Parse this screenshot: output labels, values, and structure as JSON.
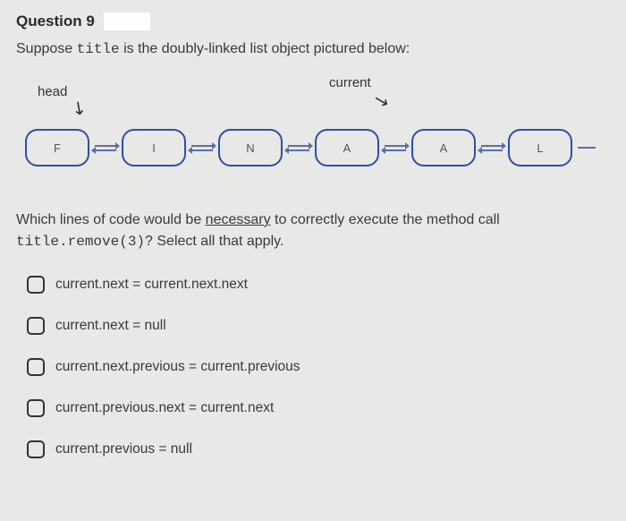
{
  "header": {
    "question_number": "Question 9"
  },
  "intro": {
    "prefix": "Suppose ",
    "code": "title",
    "suffix": "  is the doubly-linked list object pictured below:"
  },
  "diagram": {
    "head_label": "head",
    "current_label": "current",
    "nodes": [
      "F",
      "I",
      "N",
      "A",
      "A",
      "L"
    ]
  },
  "question": {
    "line1_prefix": "Which lines of code would be ",
    "necessary": "necessary",
    "line1_suffix": " to correctly execute the method call",
    "line2_code": "title.remove(3)",
    "line2_suffix": "?  Select all that apply."
  },
  "options": [
    "current.next = current.next.next",
    "current.next = null",
    "current.next.previous = current.previous",
    "current.previous.next = current.next",
    "current.previous = null"
  ]
}
